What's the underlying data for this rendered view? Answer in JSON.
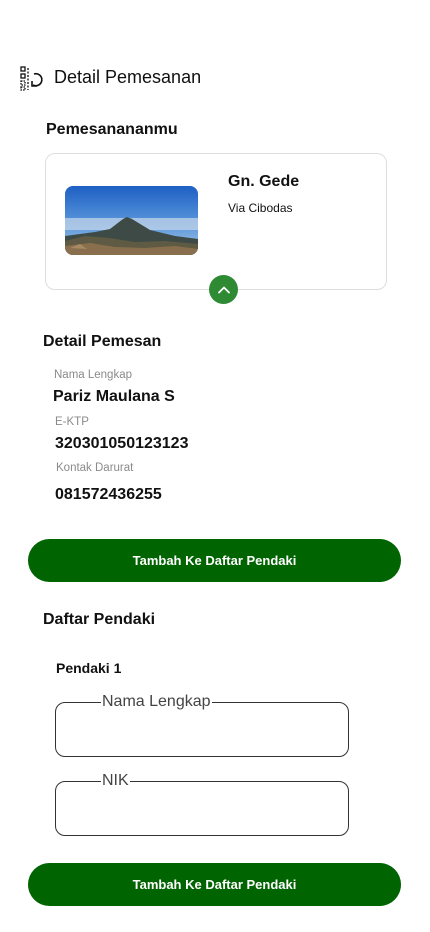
{
  "header": {
    "title": "Detail Pemesanan",
    "icon": "list-back-icon"
  },
  "booking": {
    "section_title": "Pemesanananmu",
    "mountain_name": "Gn. Gede",
    "route": "Via Cibodas",
    "expand_icon": "chevron-up-icon"
  },
  "orderer": {
    "section_title": "Detail Pemesan",
    "fields": [
      {
        "label": "Nama Lengkap",
        "value": "Pariz Maulana S"
      },
      {
        "label": "E-KTP",
        "value": "320301050123123"
      },
      {
        "label": "Kontak Darurat",
        "value": "081572436255"
      }
    ],
    "add_button_label": "Tambah Ke Daftar Pendaki"
  },
  "climbers": {
    "section_title": "Daftar Pendaki",
    "climber_label": "Pendaki 1",
    "name_field_label": "Nama Lengkap",
    "name_value": "",
    "nik_field_label": "NIK",
    "nik_value": "",
    "add_button_label": "Tambah Ke Daftar Pendaki"
  },
  "colors": {
    "primary_green": "#006400",
    "accent_green": "#2f8a34"
  }
}
